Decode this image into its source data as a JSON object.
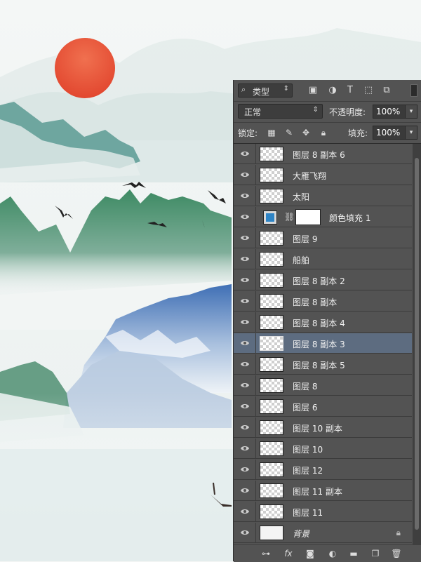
{
  "filter": {
    "kind_label": "类型",
    "search_icon": "search-icon",
    "icons": [
      "image-filter-icon",
      "adjustment-filter-icon",
      "type-filter-icon",
      "shape-filter-icon",
      "smart-object-filter-icon"
    ]
  },
  "blend": {
    "mode": "正常",
    "opacity_label": "不透明度:",
    "opacity_value": "100%"
  },
  "lock": {
    "label": "锁定:",
    "fill_label": "填充:",
    "fill_value": "100%"
  },
  "layers": [
    {
      "name": "图层 8 副本 6",
      "thumb": "transparent",
      "selected": false
    },
    {
      "name": "大雁飞翔",
      "thumb": "transparent",
      "selected": false
    },
    {
      "name": "太阳",
      "thumb": "transparent",
      "selected": false
    },
    {
      "name": "颜色填充 1",
      "thumb": "fill",
      "selected": false,
      "fill_color": "#2e84c5"
    },
    {
      "name": "图层 9",
      "thumb": "transparent",
      "selected": false
    },
    {
      "name": "船舶",
      "thumb": "transparent",
      "selected": false
    },
    {
      "name": "图层 8 副本 2",
      "thumb": "transparent",
      "selected": false
    },
    {
      "name": "图层 8 副本",
      "thumb": "transparent",
      "selected": false
    },
    {
      "name": "图层 8 副本 4",
      "thumb": "transparent",
      "selected": false
    },
    {
      "name": "图层 8 副本 3",
      "thumb": "transparent",
      "selected": true
    },
    {
      "name": "图层 8 副本 5",
      "thumb": "transparent",
      "selected": false
    },
    {
      "name": "图层 8",
      "thumb": "transparent",
      "selected": false
    },
    {
      "name": "图层 6",
      "thumb": "transparent",
      "selected": false
    },
    {
      "name": "图层 10 副本",
      "thumb": "transparent",
      "selected": false
    },
    {
      "name": "图层 10",
      "thumb": "transparent",
      "selected": false
    },
    {
      "name": "图层 12",
      "thumb": "transparent",
      "selected": false
    },
    {
      "name": "图层 11 副本",
      "thumb": "transparent",
      "selected": false
    },
    {
      "name": "图层 11",
      "thumb": "transparent",
      "selected": false
    },
    {
      "name": "背景",
      "thumb": "white",
      "selected": false,
      "locked": true
    }
  ],
  "bottom_icons": [
    "link-layers-icon",
    "fx-icon",
    "add-mask-icon",
    "adjustment-layer-icon",
    "new-group-icon",
    "new-layer-icon",
    "trash-icon"
  ],
  "colors": {
    "panel": "#535353",
    "selected_row": "#5d6c80",
    "sun": "#e8533a",
    "sky": "#f2f5f4"
  }
}
